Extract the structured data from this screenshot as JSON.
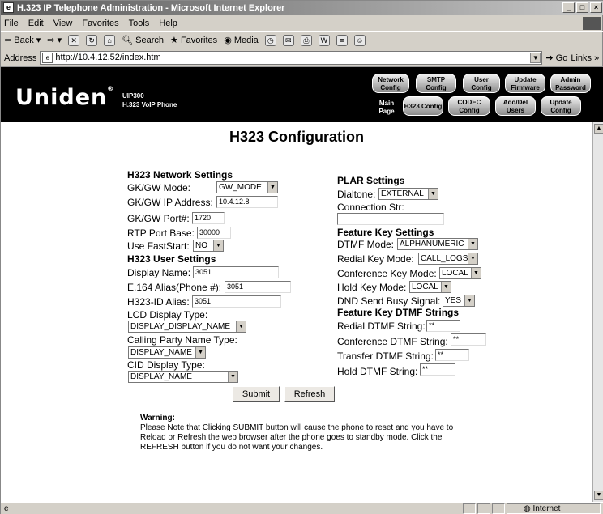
{
  "window": {
    "title": "H.323 IP Telephone Administration - Microsoft Internet Explorer",
    "controls": [
      "_",
      "□",
      "×"
    ]
  },
  "menu": [
    "File",
    "Edit",
    "View",
    "Favorites",
    "Tools",
    "Help"
  ],
  "toolbar": {
    "back": "Back",
    "search": "Search",
    "favorites": "Favorites",
    "media": "Media"
  },
  "address": {
    "label": "Address",
    "url": "http://10.4.12.52/index.htm",
    "go": "Go",
    "links": "Links »"
  },
  "banner": {
    "logo": "Uniden",
    "model_line1": "UIP300",
    "model_line2": "H.323 VoIP Phone",
    "nav_top": [
      "Network Config",
      "SMTP Config",
      "User Config",
      "Update Firmware",
      "Admin Password"
    ],
    "main_page": "Main Page",
    "nav_bottom": [
      "H323 Config",
      "CODEC Config",
      "Add/Del Users",
      "Update Config"
    ]
  },
  "page_title": "H323 Configuration",
  "network": {
    "heading": "H323 Network Settings",
    "gk_mode_label": "GK/GW Mode:",
    "gk_mode_value": "GW_MODE",
    "gk_ip_label": "GK/GW IP Address:",
    "gk_ip_value": "10.4.12.8",
    "gk_port_label": "GK/GW Port#:",
    "gk_port_value": "1720",
    "rtp_label": "RTP Port Base:",
    "rtp_value": "30000",
    "faststart_label": "Use FastStart:",
    "faststart_value": "NO"
  },
  "user": {
    "heading": "H323 User Settings",
    "display_name_label": "Display Name:",
    "display_name_value": "3051",
    "e164_label": "E.164 Alias(Phone #):",
    "e164_value": "3051",
    "h323id_label": "H323-ID Alias:",
    "h323id_value": "3051",
    "lcd_label": "LCD Display Type:",
    "lcd_value": "DISPLAY_DISPLAY_NAME",
    "calling_label": "Calling Party Name Type:",
    "calling_value": "DISPLAY_NAME",
    "cid_label": "CID Display Type:",
    "cid_value": "DISPLAY_NAME"
  },
  "plar": {
    "heading": "PLAR Settings",
    "dialtone_label": "Dialtone:",
    "dialtone_value": "EXTERNAL",
    "connection_label": "Connection Str:",
    "connection_value": ""
  },
  "feature": {
    "heading": "Feature Key Settings",
    "dtmf_mode_label": "DTMF Mode:",
    "dtmf_mode_value": "ALPHANUMERIC",
    "redial_label": "Redial Key Mode:",
    "redial_value": "CALL_LOGS",
    "conference_label": "Conference Key Mode:",
    "conference_value": "LOCAL",
    "hold_label": "Hold Key Mode:",
    "hold_value": "LOCAL",
    "dnd_label": "DND Send Busy Signal:",
    "dnd_value": "YES"
  },
  "dtmf": {
    "heading": "Feature Key DTMF Strings",
    "redial_label": "Redial DTMF String:",
    "redial_value": "**",
    "conference_label": "Conference DTMF String:",
    "conference_value": "**",
    "transfer_label": "Transfer DTMF String:",
    "transfer_value": "**",
    "hold_label": "Hold DTMF String:",
    "hold_value": "**"
  },
  "buttons": {
    "submit": "Submit",
    "refresh": "Refresh"
  },
  "warning": {
    "title": "Warning:",
    "text": "Please Note that Clicking SUBMIT button will cause the phone to reset and you have to Reload or Refresh the web browser after the phone goes to standby mode. Click the REFRESH button if you do not want your changes."
  },
  "status": {
    "zone": "Internet"
  },
  "icons": {
    "dropdown": "dropdown-arrow-icon",
    "app": "ie-icon"
  }
}
